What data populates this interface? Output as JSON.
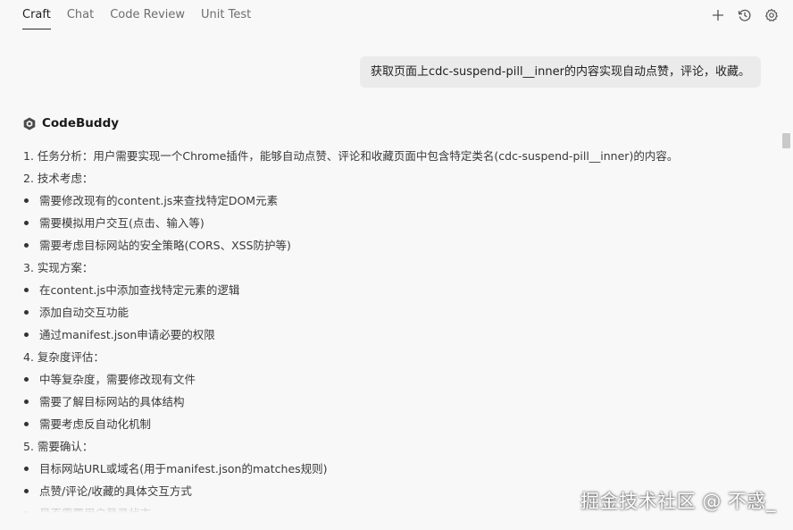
{
  "tabs": [
    {
      "label": "Craft",
      "active": true
    },
    {
      "label": "Chat",
      "active": false
    },
    {
      "label": "Code Review",
      "active": false
    },
    {
      "label": "Unit Test",
      "active": false
    }
  ],
  "toolbar": {
    "icons": [
      "plus-icon",
      "history-icon",
      "settings-icon"
    ]
  },
  "user_message": "获取页面上cdc-suspend-pill__inner的内容实现自动点赞，评论，收藏。",
  "assistant": {
    "name": "CodeBuddy",
    "lines": [
      {
        "type": "text",
        "text": "1. 任务分析：用户需要实现一个Chrome插件，能够自动点赞、评论和收藏页面中包含特定类名(cdc-suspend-pill__inner)的内容。"
      },
      {
        "type": "text",
        "text": "2. 技术考虑："
      },
      {
        "type": "bullet",
        "text": "需要修改现有的content.js来查找特定DOM元素"
      },
      {
        "type": "bullet",
        "text": "需要模拟用户交互(点击、输入等)"
      },
      {
        "type": "bullet",
        "text": "需要考虑目标网站的安全策略(CORS、XSS防护等)"
      },
      {
        "type": "text",
        "text": "3. 实现方案："
      },
      {
        "type": "bullet",
        "text": "在content.js中添加查找特定元素的逻辑"
      },
      {
        "type": "bullet",
        "text": "添加自动交互功能"
      },
      {
        "type": "bullet",
        "text": "通过manifest.json申请必要的权限"
      },
      {
        "type": "text",
        "text": "4. 复杂度评估："
      },
      {
        "type": "bullet",
        "text": "中等复杂度，需要修改现有文件"
      },
      {
        "type": "bullet",
        "text": "需要了解目标网站的具体结构"
      },
      {
        "type": "bullet",
        "text": "需要考虑反自动化机制"
      },
      {
        "type": "text",
        "text": "5. 需要确认："
      },
      {
        "type": "bullet",
        "text": "目标网站URL或域名(用于manifest.json的matches规则)"
      },
      {
        "type": "bullet",
        "text": "点赞/评论/收藏的具体交互方式"
      },
      {
        "type": "bullet",
        "text": "是否需要用户登录状态"
      }
    ]
  },
  "watermark": "掘金技术社区 @ 不惑_"
}
